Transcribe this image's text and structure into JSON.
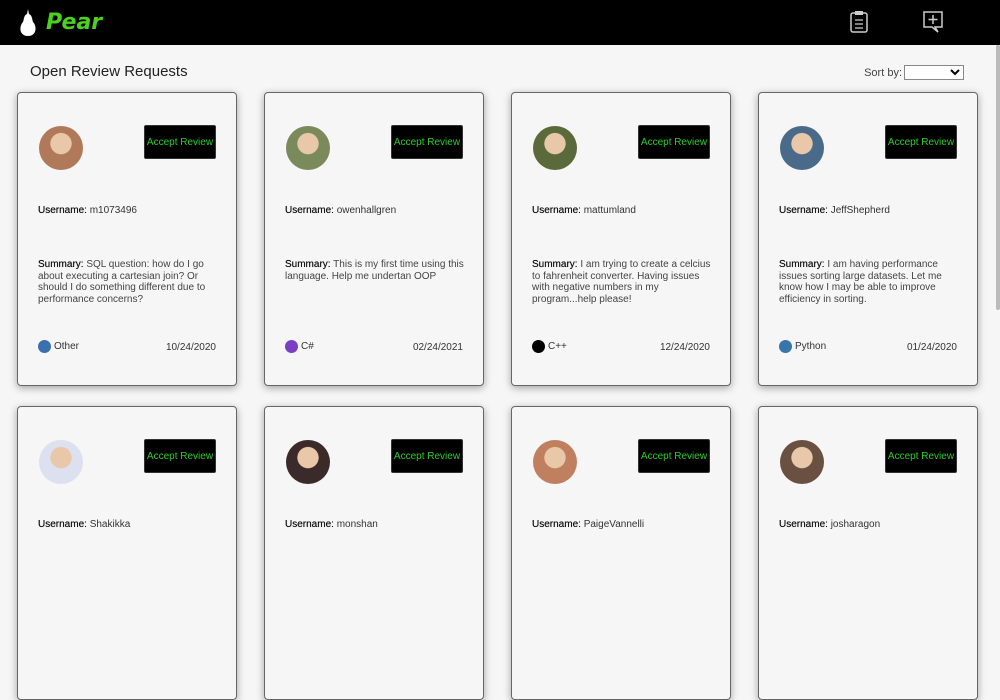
{
  "app": {
    "name": "Pear"
  },
  "page": {
    "title": "Open Review Requests",
    "sort_label": "Sort by:",
    "sort_value": ""
  },
  "labels": {
    "username": "Username:",
    "summary": "Summary:",
    "accept": "Accept Review"
  },
  "cards": [
    {
      "username": "m1073496",
      "summary": "SQL question: how do I go about executing a cartesian join? Or should I do something different due to performance concerns?",
      "language": "Other",
      "date": "10/24/2020",
      "avatar_color": "#b07a5a",
      "lang_color": "#3a6fb0"
    },
    {
      "username": "owenhallgren",
      "summary": "This is my first time using this language. Help me undertan OOP",
      "language": "C#",
      "date": "02/24/2021",
      "avatar_color": "#7a8a5a",
      "lang_color": "#7b3fc4"
    },
    {
      "username": "mattumland",
      "summary": "I am trying to create a celcius to fahrenheit converter. Having issues with negative numbers in my program...help please!",
      "language": "C++",
      "date": "12/24/2020",
      "avatar_color": "#5a6a3a",
      "lang_color": "#000000"
    },
    {
      "username": "JeffShepherd",
      "summary": "I am having performance issues sorting large datasets. Let me know how I may be able to improve efficiency in sorting.",
      "language": "Python",
      "date": "01/24/2020",
      "avatar_color": "#4a6a8a",
      "lang_color": "#3776ab"
    },
    {
      "username": "Shakikka",
      "avatar_color": "#dde0ee"
    },
    {
      "username": "monshan",
      "avatar_color": "#3a2a2a"
    },
    {
      "username": "PaigeVannelli",
      "avatar_color": "#c08060"
    },
    {
      "username": "josharagon",
      "avatar_color": "#6a5040"
    }
  ]
}
